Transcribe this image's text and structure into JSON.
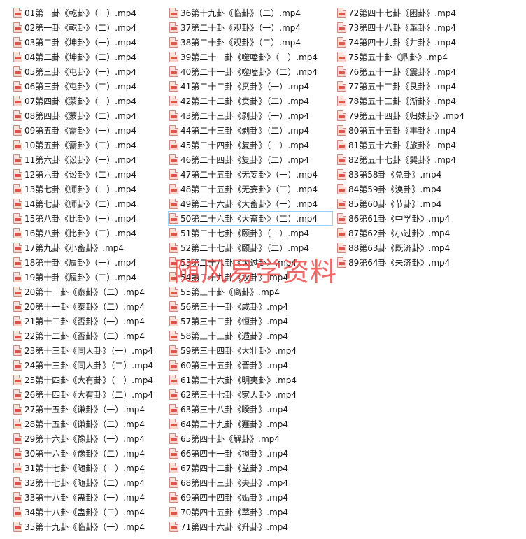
{
  "watermark": "随风易学资料",
  "columns": [
    [
      "01第一卦《乾卦》（一）.mp4",
      "02第一卦《乾卦》（二）.mp4",
      "03第二卦《坤卦》（一）.mp4",
      "04第二卦《坤卦》（二）.mp4",
      "05第三卦《屯卦》（一）.mp4",
      "06第三卦《屯卦》（二）.mp4",
      "07第四卦《蒙卦》（一）.mp4",
      "08第四卦《蒙卦》（二）.mp4",
      "09第五卦《需卦》（一）.mp4",
      "10第五卦《需卦》（二）.mp4",
      "11第六卦《讼卦》（一）.mp4",
      "12第六卦《讼卦》（二）.mp4",
      "13第七卦《师卦》（一）.mp4",
      "14第七卦《师卦》（二）.mp4",
      "15第八卦《比卦》（一）.mp4",
      "16第八卦《比卦》（二）.mp4",
      "17第九卦《小畜卦》.mp4",
      "18第十卦《履卦》（一）.mp4",
      "19第十卦《履卦》（二）.mp4",
      "20第十一卦《泰卦》（二）.mp4",
      "20第十一卦《泰卦》（二）.mp4",
      "21第十二卦《否卦》（一）.mp4",
      "22第十二卦《否卦》（二）.mp4",
      "23第十三卦《同人卦》（一）.mp4",
      "24第十三卦《同人卦》（二）.mp4",
      "25第十四卦《大有卦》（一）.mp4",
      "26第十四卦《大有卦》（二）.mp4",
      "27第十五卦《谦卦》（一）.mp4",
      "28第十五卦《谦卦》（二）.mp4",
      "29第十六卦《豫卦》（一）.mp4",
      "30第十六卦《豫卦》（二）.mp4",
      "31第十七卦《随卦》（一）.mp4",
      "32第十七卦《随卦》（二）.mp4",
      "33第十八卦《蛊卦》（一）.mp4",
      "34第十八卦《蛊卦》（二）.mp4",
      "35第十九卦《临卦》（一）.mp4"
    ],
    [
      "36第十九卦《临卦》（二）.mp4",
      "37第二十卦《观卦》（一）.mp4",
      "38第二十卦《观卦》（二）.mp4",
      "39第二十一卦《噬嗑卦》（一）.mp4",
      "40第二十一卦《噬嗑卦》（二）.mp4",
      "41第二十二卦《贲卦》（一）.mp4",
      "42第二十二卦《贲卦》（二）.mp4",
      "43第二十三卦《剥卦》（一）.mp4",
      "44第二十三卦《剥卦》（二）.mp4",
      "45第二十四卦《复卦》（一）.mp4",
      "46第二十四卦《复卦》（二）.mp4",
      "47第二十五卦《无妄卦》（一）.mp4",
      "48第二十五卦《无妄卦》（二）.mp4",
      "49第二十六卦《大畜卦》（一）.mp4",
      "50第二十六卦《大畜卦》（二）.mp4",
      "51第二十七卦《颐卦》（一）.mp4",
      "52第二十七卦《颐卦》（二）.mp4",
      "53第二十八卦《大过卦》.mp4",
      "54第二十九卦《坎卦》.mp4",
      "55第三十卦《离卦》.mp4",
      "56第三十一卦《咸卦》.mp4",
      "57第三十二卦《恒卦》.mp4",
      "58第三十三卦《遁卦》.mp4",
      "59第三十四卦《大壮卦》.mp4",
      "60第三十五卦《晋卦》.mp4",
      "61第三十六卦《明夷卦》.mp4",
      "62第三十七卦《家人卦》.mp4",
      "63第三十八卦《睽卦》.mp4",
      "64第三十九卦《蹇卦》.mp4",
      "65第四十卦《解卦》.mp4",
      "66第四十一卦《损卦》.mp4",
      "67第四十二卦《益卦》.mp4",
      "68第四十三卦《夬卦》.mp4",
      "69第四十四卦《姤卦》.mp4",
      "70第四十五卦《萃卦》.mp4",
      "71第四十六卦《升卦》.mp4"
    ],
    [
      "72第四十七卦《困卦》.mp4",
      "73第四十八卦《革卦》.mp4",
      "74第四十九卦《井卦》.mp4",
      "75第五十卦《鼎卦》.mp4",
      "76第五十一卦《震卦》.mp4",
      "77第五十二卦《艮卦》.mp4",
      "78第五十三卦《渐卦》.mp4",
      "79第五十四卦《归妹卦》.mp4",
      "80第五十五卦《丰卦》.mp4",
      "81第五十六卦《旅卦》.mp4",
      "82第五十七卦《巽卦》.mp4",
      "83第58卦《兑卦》.mp4",
      "84第59卦《涣卦》.mp4",
      "85第60卦《节卦》.mp4",
      "86第61卦《中孚卦》.mp4",
      "87第62卦《小过卦》.mp4",
      "88第63卦《既济卦》.mp4",
      "89第64卦《未济卦》.mp4"
    ]
  ],
  "selected_item": "50第二十六卦《大畜卦》（二）.mp4",
  "icon": {
    "name": "video-file-icon",
    "color": "#d9574a"
  }
}
